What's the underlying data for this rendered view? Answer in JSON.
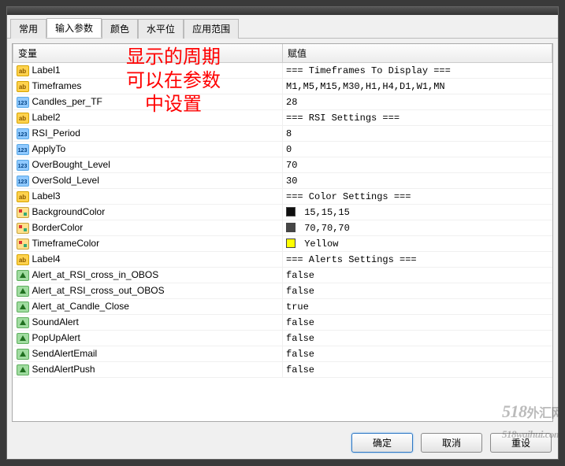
{
  "tabs": [
    {
      "label": "常用"
    },
    {
      "label": "输入参数"
    },
    {
      "label": "颜色"
    },
    {
      "label": "水平位"
    },
    {
      "label": "应用范围"
    }
  ],
  "active_tab": 1,
  "headers": {
    "name": "变量",
    "value": "赋值"
  },
  "overlay": {
    "l1": "显示的周期",
    "l2": "可以在参数",
    "l3": "中设置"
  },
  "watermark": {
    "main": "518",
    "sub": "外汇网",
    "domain": "518waihui.com"
  },
  "buttons": {
    "ok": "确定",
    "cancel": "取消",
    "reset": "重设"
  },
  "rows": [
    {
      "type": "ab",
      "name": "Label1",
      "val": "=== Timeframes To Display ==="
    },
    {
      "type": "ab",
      "name": "Timeframes",
      "val": "M1,M5,M15,M30,H1,H4,D1,W1,MN"
    },
    {
      "type": "123",
      "name": "Candles_per_TF",
      "val": "28"
    },
    {
      "type": "ab",
      "name": "Label2",
      "val": "=== RSI Settings ==="
    },
    {
      "type": "123",
      "name": "RSI_Period",
      "val": "8"
    },
    {
      "type": "123",
      "name": "ApplyTo",
      "val": "0"
    },
    {
      "type": "123",
      "name": "OverBought_Level",
      "val": "70"
    },
    {
      "type": "123",
      "name": "OverSold_Level",
      "val": "30"
    },
    {
      "type": "ab",
      "name": "Label3",
      "val": "=== Color Settings ==="
    },
    {
      "type": "col",
      "name": "BackgroundColor",
      "val": "15,15,15",
      "swatch": "#0f0f0f"
    },
    {
      "type": "col",
      "name": "BorderColor",
      "val": "70,70,70",
      "swatch": "#464646"
    },
    {
      "type": "col",
      "name": "TimeframeColor",
      "val": "Yellow",
      "swatch": "#ffff00"
    },
    {
      "type": "ab",
      "name": "Label4",
      "val": "=== Alerts Settings ==="
    },
    {
      "type": "bool",
      "name": "Alert_at_RSI_cross_in_OBOS",
      "val": "false"
    },
    {
      "type": "bool",
      "name": "Alert_at_RSI_cross_out_OBOS",
      "val": "false"
    },
    {
      "type": "bool",
      "name": "Alert_at_Candle_Close",
      "val": "true"
    },
    {
      "type": "bool",
      "name": "SoundAlert",
      "val": "false"
    },
    {
      "type": "bool",
      "name": "PopUpAlert",
      "val": "false"
    },
    {
      "type": "bool",
      "name": "SendAlertEmail",
      "val": "false"
    },
    {
      "type": "bool",
      "name": "SendAlertPush",
      "val": "false"
    }
  ]
}
